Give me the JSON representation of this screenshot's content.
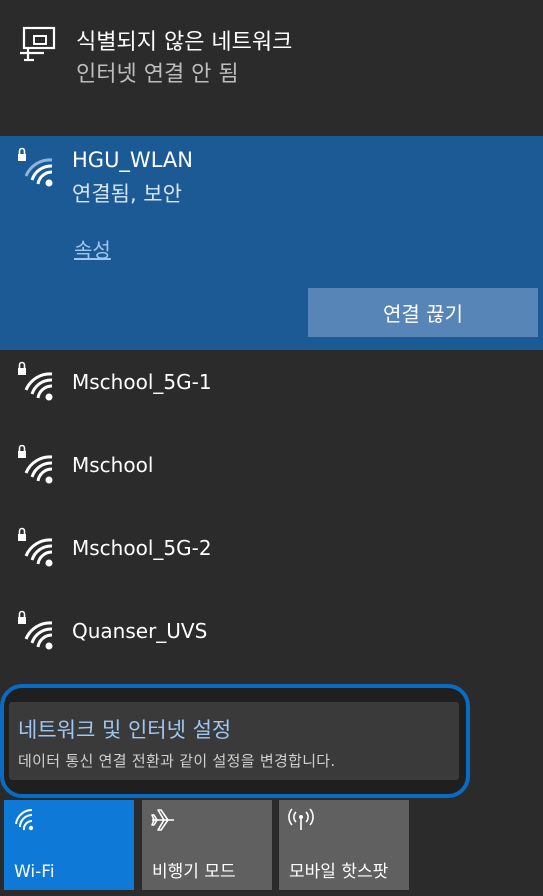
{
  "unidentified_network": {
    "title": "식별되지 않은 네트워크",
    "subtitle": "인터넷 연결 안 됨"
  },
  "connected_network": {
    "ssid": "HGU_WLAN",
    "status": "연결됨, 보안",
    "properties_link": "속성",
    "disconnect_label": "연결 끊기"
  },
  "networks": [
    {
      "ssid": "Mschool_5G-1"
    },
    {
      "ssid": "Mschool"
    },
    {
      "ssid": "Mschool_5G-2"
    },
    {
      "ssid": "Quanser_UVS"
    }
  ],
  "settings_link": {
    "title": "네트워크 및 인터넷 설정",
    "description": "데이터 통신 연결 전환과 같이 설정을 변경합니다."
  },
  "quick_actions": [
    {
      "label": "Wi-Fi",
      "icon": "wifi-icon",
      "active": true
    },
    {
      "label": "비행기 모드",
      "icon": "airplane-icon",
      "active": false
    },
    {
      "label": "모바일 핫스팟",
      "icon": "hotspot-icon",
      "active": false
    }
  ],
  "colors": {
    "background": "#2b2b2b",
    "selected": "#1c5a96",
    "accent": "#0f79d8",
    "link": "#9ec8f2"
  }
}
